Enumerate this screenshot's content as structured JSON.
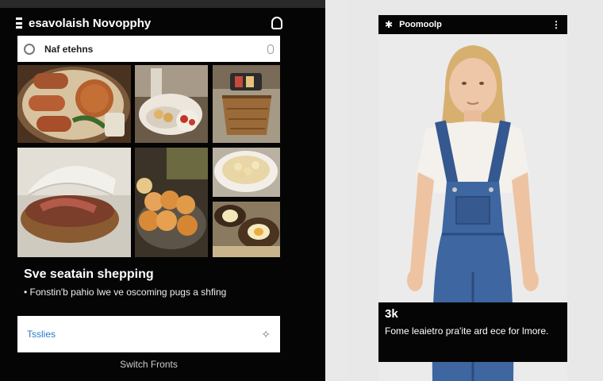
{
  "left": {
    "app_title": "esavolaish Novopphy",
    "search_label": "Naf etehns",
    "overlay_title": "Sve seatain shepping",
    "overlay_desc": "• Fonstin'b pahio lwe ve oscoming pugs a shfing",
    "action_label": "Tsslies",
    "footer": "Switch Fronts"
  },
  "right": {
    "header_title": "Poomoolp",
    "card_title": "3k",
    "card_text": "Fome leaietro pra'ite ard ece for lmore."
  },
  "colors": {
    "accent": "#2879c9"
  }
}
